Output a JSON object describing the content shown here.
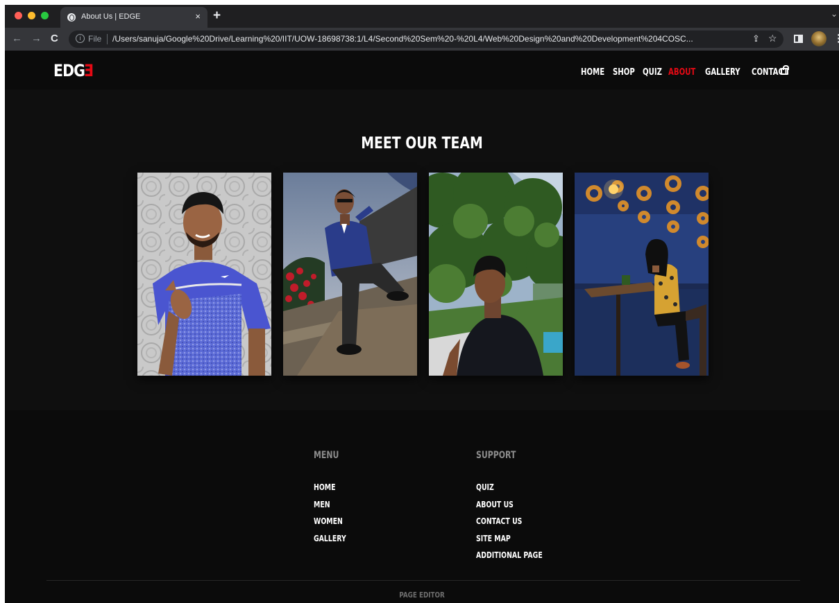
{
  "browser": {
    "tab_title": "About Us | EDGE",
    "tab_close": "×",
    "new_tab": "+",
    "scheme_label": "File",
    "url": "/Users/sanuja/Google%20Drive/Learning%20/IIT/UOW-18698738:1/L4/Second%20Sem%20-%20L4/Web%20Design%20and%20Development%204COSC...",
    "icons": [
      "back-icon",
      "forward-icon",
      "reload-icon",
      "info-icon",
      "share-icon",
      "bookmark-star-icon",
      "side-panel-icon",
      "profile-avatar",
      "menu-kebab-icon"
    ],
    "traffic_colors": [
      "#ff5f57",
      "#febc2e",
      "#28c840"
    ]
  },
  "site": {
    "logo_main": "EDG",
    "logo_accent": "E",
    "accent_color": "#e50914",
    "nav": [
      "HOME",
      "SHOP",
      "QUIZ",
      "ABOUT",
      "GALLERY",
      "CONTACT"
    ],
    "active_nav": "ABOUT",
    "cart_icon": "shopping-bag-icon"
  },
  "team": {
    "title": "MEET OUR TEAM"
  },
  "footer": {
    "menu_title": "MENU",
    "menu_links": [
      "HOME",
      "MEN",
      "WOMEN",
      "GALLERY"
    ],
    "support_title": "SUPPORT",
    "support_links": [
      "QUIZ",
      "ABOUT US",
      "CONTACT US",
      "SITE MAP",
      "ADDITIONAL PAGE"
    ],
    "bottom_text": "PAGE EDITOR"
  }
}
